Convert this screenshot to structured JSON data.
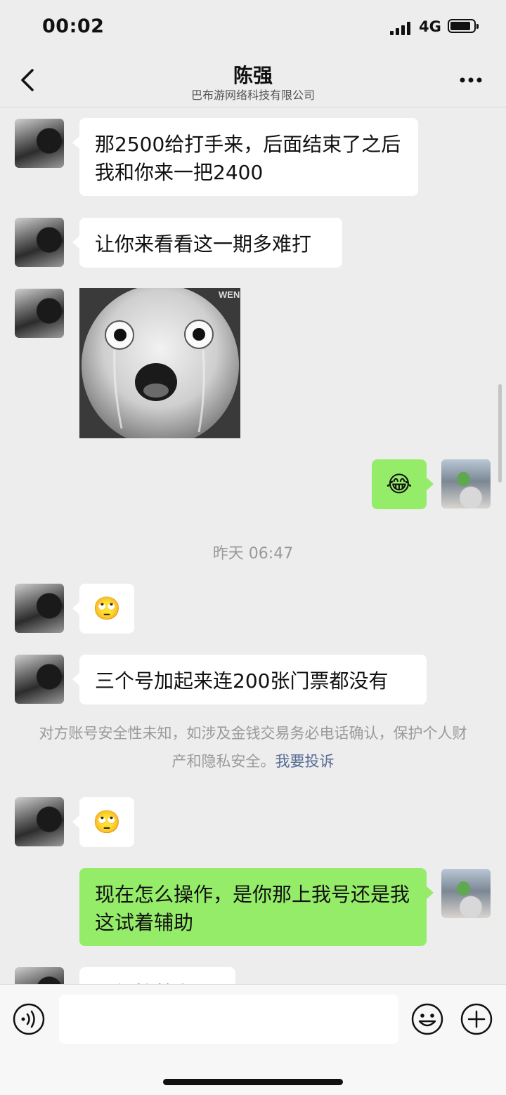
{
  "status_bar": {
    "time": "00:02",
    "network": "4G"
  },
  "header": {
    "title": "陈强",
    "subtitle": "巴布游网络科技有限公司"
  },
  "messages": [
    {
      "from": "other",
      "text": "那2500给打手来，后面结束了之后我和你来一把2400"
    },
    {
      "from": "other",
      "text": "让你来看看这一期多难打"
    },
    {
      "from": "other",
      "type": "sticker",
      "watermark": "WEN"
    },
    {
      "from": "self",
      "emoji": "😂"
    },
    {
      "type": "timestamp",
      "text": "昨天 06:47"
    },
    {
      "from": "other",
      "emoji": "🙄"
    },
    {
      "from": "other",
      "text": "三个号加起来连200张门票都没有"
    },
    {
      "type": "notice",
      "text": "对方账号安全性未知，如涉及金钱交易务必电话确认，保护个人财产和隐私安全。",
      "link": "我要投诉"
    },
    {
      "from": "other",
      "emoji": "🙄"
    },
    {
      "from": "self",
      "text": "现在怎么操作，是你那上我号还是我这试着辅助"
    },
    {
      "from": "other",
      "text": "还得炉着上面"
    }
  ],
  "colors": {
    "self_bubble": "#95ec69",
    "other_bubble": "#ffffff",
    "link": "#576b95",
    "background": "#ededed"
  }
}
